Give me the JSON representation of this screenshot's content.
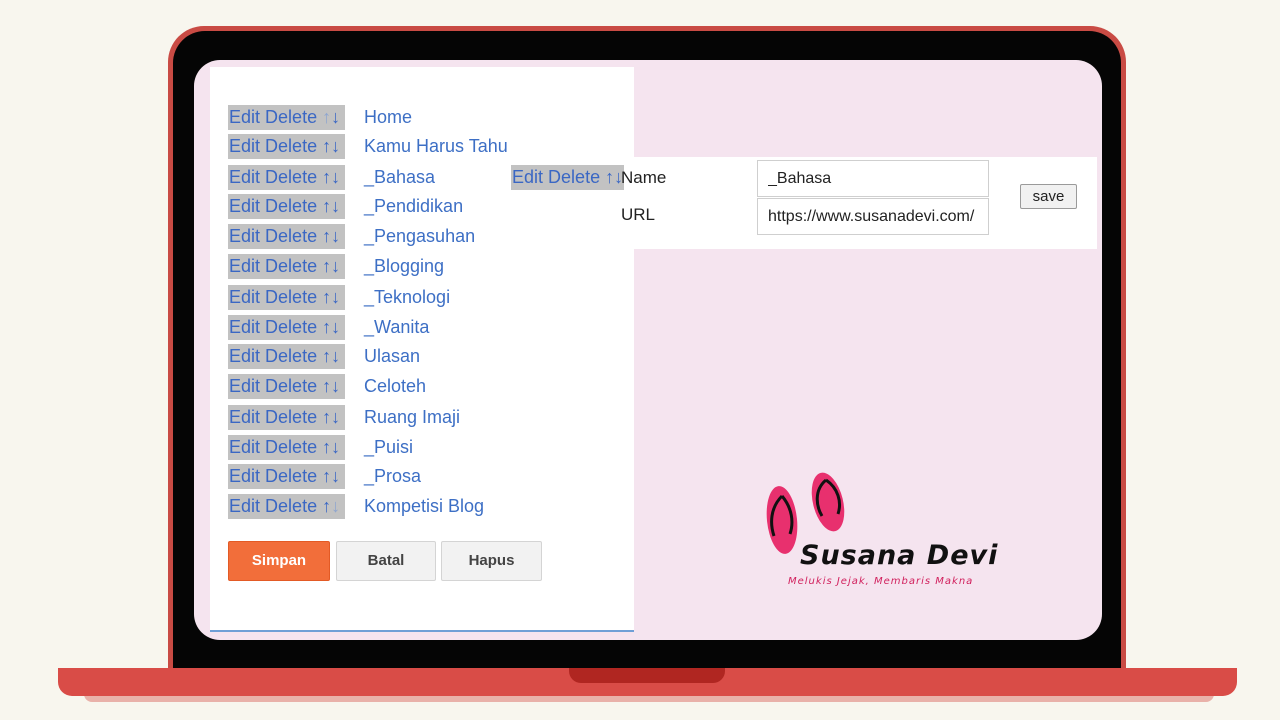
{
  "controls": {
    "edit": "Edit",
    "delete": "Delete",
    "up": "↑",
    "down": "↓"
  },
  "links": [
    {
      "name": "Home"
    },
    {
      "name": "Kamu Harus Tahu"
    },
    {
      "name": "_Bahasa"
    },
    {
      "name": "_Pendidikan"
    },
    {
      "name": "_Pengasuhan"
    },
    {
      "name": "_Blogging"
    },
    {
      "name": "_Teknologi"
    },
    {
      "name": "_Wanita"
    },
    {
      "name": "Ulasan"
    },
    {
      "name": "Celoteh"
    },
    {
      "name": "Ruang Imaji"
    },
    {
      "name": "_Puisi"
    },
    {
      "name": "_Prosa"
    },
    {
      "name": "Kompetisi Blog"
    }
  ],
  "buttons": {
    "save": "Simpan",
    "cancel": "Batal",
    "delete": "Hapus"
  },
  "edit_form": {
    "name_label": "Name",
    "name_value": "_Bahasa",
    "url_label": "URL",
    "url_value": "https://www.susanadevi.com/",
    "save_label": "save"
  },
  "brand": {
    "name": "Susana Devi",
    "tagline": "Melukis Jejak, Membaris Makna",
    "accent_color": "#e8306e",
    "primary_button_color": "#f26e3a"
  }
}
